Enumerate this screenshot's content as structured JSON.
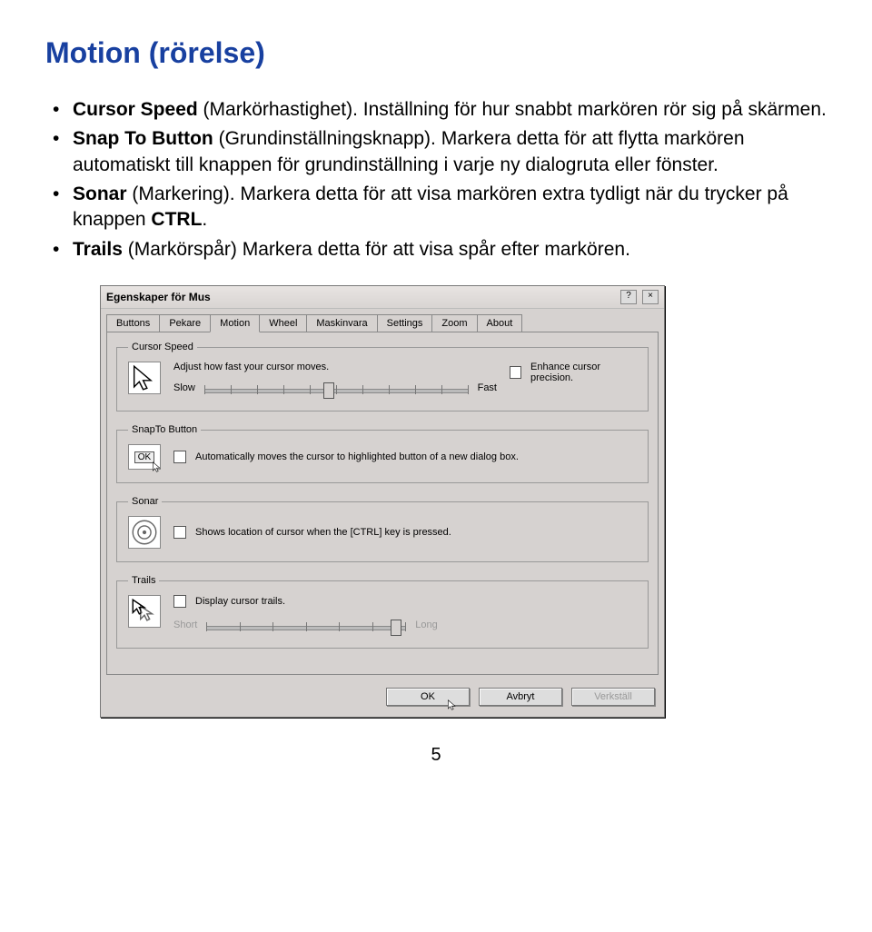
{
  "heading": "Motion (rörelse)",
  "bullets": [
    {
      "bold": "Cursor Speed",
      "paren": " (Markörhastighet). ",
      "text": "Inställning för hur snabbt markören rör sig på skärmen."
    },
    {
      "bold": "Snap To Button",
      "paren": " (Grundinställningsknapp). ",
      "text": "Markera detta för att flytta markören automatiskt till knappen för grundinställning i varje ny dialogruta eller fönster."
    },
    {
      "bold": "Sonar",
      "paren": " (Markering). ",
      "text": "Markera detta för att visa markören extra tydligt när du trycker på knappen ",
      "bold2": "CTRL",
      "tail": "."
    },
    {
      "bold": "Trails",
      "paren": " (Markörspår) ",
      "text": "Markera detta för att visa spår efter markören."
    }
  ],
  "dialog": {
    "title": "Egenskaper för Mus",
    "help_btn": "?",
    "close_btn": "×",
    "tabs": [
      "Buttons",
      "Pekare",
      "Motion",
      "Wheel",
      "Maskinvara",
      "Settings",
      "Zoom",
      "About"
    ],
    "active_tab": "Motion",
    "groups": {
      "cursor_speed": {
        "legend": "Cursor Speed",
        "desc": "Adjust how fast your cursor moves.",
        "slow": "Slow",
        "fast": "Fast",
        "enhance": "Enhance cursor precision."
      },
      "snapto": {
        "legend": "SnapTo Button",
        "ok_mini": "OK",
        "label": "Automatically moves the cursor to highlighted button of a new dialog box."
      },
      "sonar": {
        "legend": "Sonar",
        "label": "Shows location of cursor when the [CTRL] key is pressed."
      },
      "trails": {
        "legend": "Trails",
        "label": "Display cursor trails.",
        "short": "Short",
        "long": "Long"
      }
    },
    "buttons": {
      "ok": "OK",
      "cancel": "Avbryt",
      "apply": "Verkställ"
    }
  },
  "page_number": "5"
}
